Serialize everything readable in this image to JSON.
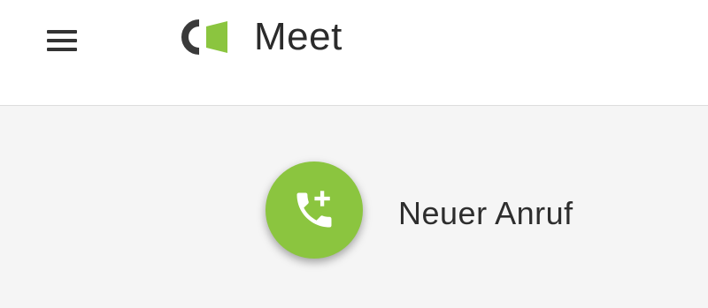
{
  "header": {
    "menu_icon": "hamburger-menu-icon",
    "logo_icon": "meet-logo-icon",
    "app_name": "Meet"
  },
  "actions": {
    "new_call": {
      "icon": "phone-add-icon",
      "label": "Neuer Anruf"
    }
  },
  "colors": {
    "accent": "#8bc53f",
    "logo_dark": "#3a3a3a",
    "text": "#2d2d2d",
    "background": "#f5f5f5"
  }
}
